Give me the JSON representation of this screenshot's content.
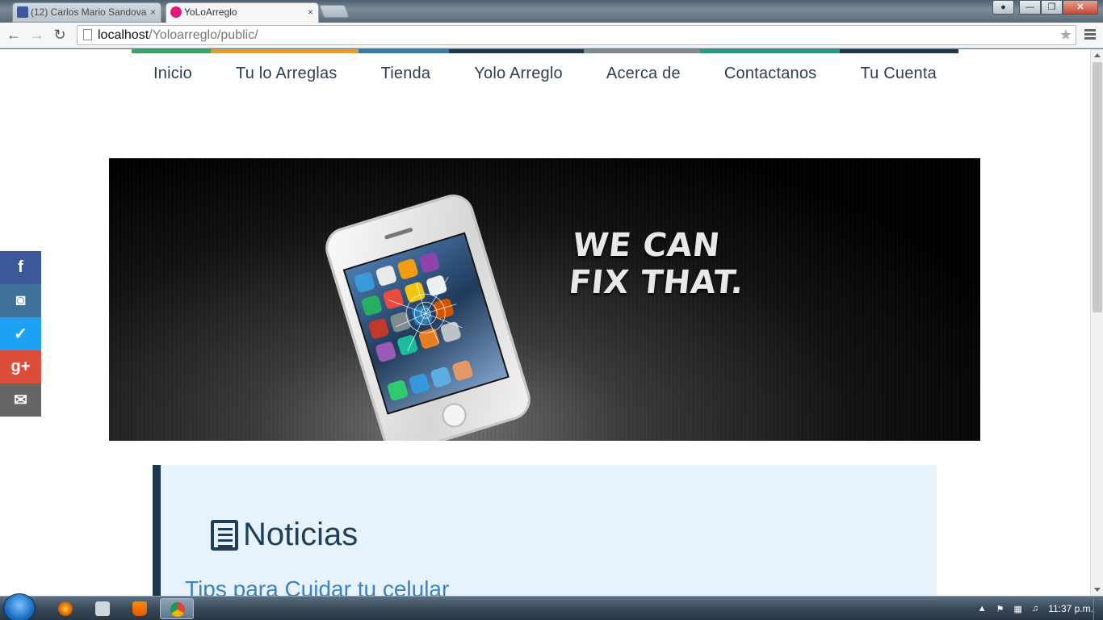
{
  "browser": {
    "tabs": [
      {
        "title": "(12) Carlos Mario Sandova",
        "icon": "facebook-icon",
        "active": false
      },
      {
        "title": "YoLoArreglo",
        "icon": "site-favicon",
        "active": true
      }
    ],
    "close_glyph": "×",
    "address": {
      "host": "localhost",
      "path": "/Yoloarreglo/public/"
    },
    "colors": {
      "titlebar": "#5a6a77",
      "toolbar": "#f5f6f7"
    }
  },
  "site": {
    "colorbar": [
      "#27ae60",
      "#f39c12",
      "#2980b9",
      "#1a3a52",
      "#7f8c8d",
      "#16a085",
      "#1a3a52"
    ],
    "nav": [
      {
        "label": "Inicio"
      },
      {
        "label": "Tu lo Arreglas"
      },
      {
        "label": "Tienda"
      },
      {
        "label": "Yolo Arreglo"
      },
      {
        "label": "Acerca de"
      },
      {
        "label": "Contactanos"
      },
      {
        "label": "Tu Cuenta"
      }
    ],
    "hero": {
      "line1": "WE CAN",
      "line2": "FIX THAT."
    },
    "news": {
      "title": "Noticias",
      "first_item": "Tips para Cuidar tu celular"
    },
    "social": [
      {
        "name": "facebook",
        "glyph": "f",
        "color": "#3b5998"
      },
      {
        "name": "instagram",
        "glyph": "◙",
        "color": "#3f729b"
      },
      {
        "name": "twitter",
        "glyph": "✓",
        "color": "#1da1f2"
      },
      {
        "name": "google-plus",
        "glyph": "g+",
        "color": "#dd4b39"
      },
      {
        "name": "email",
        "glyph": "✉",
        "color": "#666666"
      }
    ]
  },
  "taskbar": {
    "apps": [
      "firefox",
      "shield",
      "vlc",
      "chrome"
    ],
    "active_app": "chrome",
    "clock": "11:37 p.m."
  }
}
